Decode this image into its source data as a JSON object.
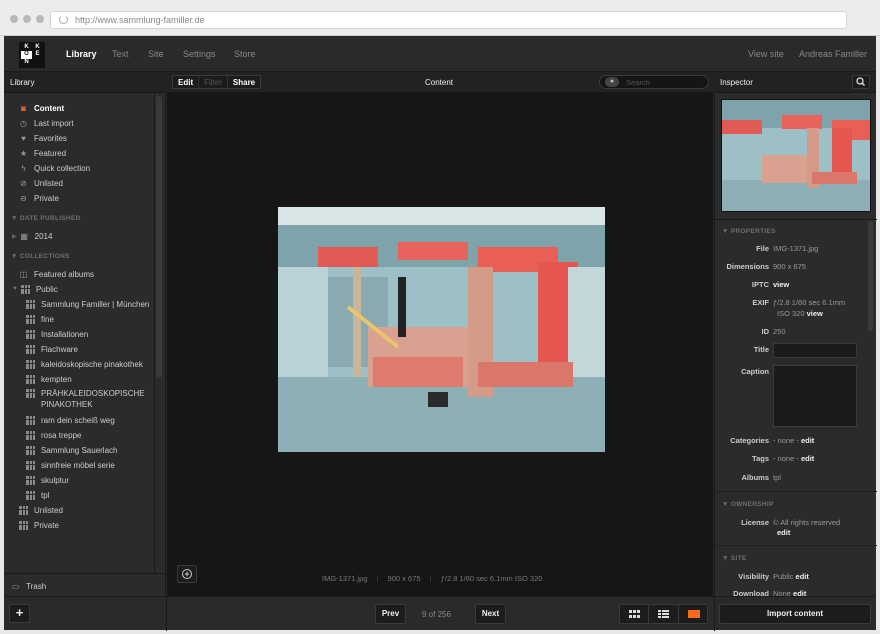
{
  "browser": {
    "url": "http://www.sammlung-familler.de"
  },
  "logo": {
    "letters": [
      "K",
      "K",
      "O",
      "E",
      "N"
    ]
  },
  "nav": {
    "items": [
      "Library",
      "Text",
      "Site",
      "Settings",
      "Store"
    ],
    "active": "Library",
    "view_site": "View site",
    "user": "Andreas Familler"
  },
  "library": {
    "title": "Library",
    "primary": [
      {
        "label": "Content",
        "icon": "camera-icon",
        "selected": true
      },
      {
        "label": "Last import",
        "icon": "clock-icon"
      },
      {
        "label": "Favorites",
        "icon": "heart-icon"
      },
      {
        "label": "Featured",
        "icon": "star-icon"
      },
      {
        "label": "Quick collection",
        "icon": "bolt-icon"
      },
      {
        "label": "Unlisted",
        "icon": "eye-slash-icon"
      },
      {
        "label": "Private",
        "icon": "lock-icon"
      }
    ],
    "date_section": "DATE PUBLISHED",
    "date_items": [
      "2014"
    ],
    "collections_section": "COLLECTIONS",
    "featured_albums": "Featured albums",
    "public": "Public",
    "albums": [
      "Sammlung Familler | München",
      "fine",
      "Installationen",
      "Flachware",
      "kaleidoskopische pinakothek",
      "kempten",
      "PRÄHKALEIDOSKOPISCHE PINAKOTHEK",
      "ram dein scheiß weg",
      "rosa treppe",
      "Sammlung Sauerlach",
      "sinnfreie möbel serie",
      "skulptur",
      "tpl"
    ],
    "unlisted": "Unlisted",
    "private": "Private",
    "trash": "Trash"
  },
  "content": {
    "title": "Content",
    "tabs": [
      "Edit",
      "Filter",
      "Share"
    ],
    "search_placeholder": "Search",
    "filename": "IMG-1371.jpg",
    "dimensions": "900 x 675",
    "exif": "ƒ/2.8  1/60 sec  6.1mm  ISO 320",
    "pager": {
      "prev": "Prev",
      "position": "9 of 256",
      "next": "Next"
    }
  },
  "inspector": {
    "title": "Inspector",
    "properties_section": "PROPERTIES",
    "file_label": "File",
    "file": "IMG-1371.jpg",
    "dimensions_label": "Dimensions",
    "dimensions": "900 x 675",
    "iptc_label": "IPTC",
    "iptc": "view",
    "exif_label": "EXIF",
    "exif_line1": "ƒ/2.8  1/60 sec  6.1mm",
    "exif_line2": "ISO 320",
    "exif_view": "view",
    "id_label": "ID",
    "id": "250",
    "title_label": "Title",
    "caption_label": "Caption",
    "categories_label": "Categories",
    "categories": "- none -",
    "categories_edit": "edit",
    "tags_label": "Tags",
    "tags": "- none -",
    "tags_edit": "edit",
    "albums_label": "Albums",
    "albums": "tpl",
    "ownership_section": "OWNERSHIP",
    "license_label": "License",
    "license": "© All rights reserved",
    "license_edit": "edit",
    "site_section": "SITE",
    "visibility_label": "Visibility",
    "visibility": "Public",
    "visibility_edit": "edit",
    "download_label": "Download",
    "download": "None",
    "download_edit": "edit"
  },
  "bottom": {
    "add": "+",
    "import": "Import content"
  },
  "colors": {
    "accent": "#ff6a1a",
    "bg": "#262626"
  }
}
